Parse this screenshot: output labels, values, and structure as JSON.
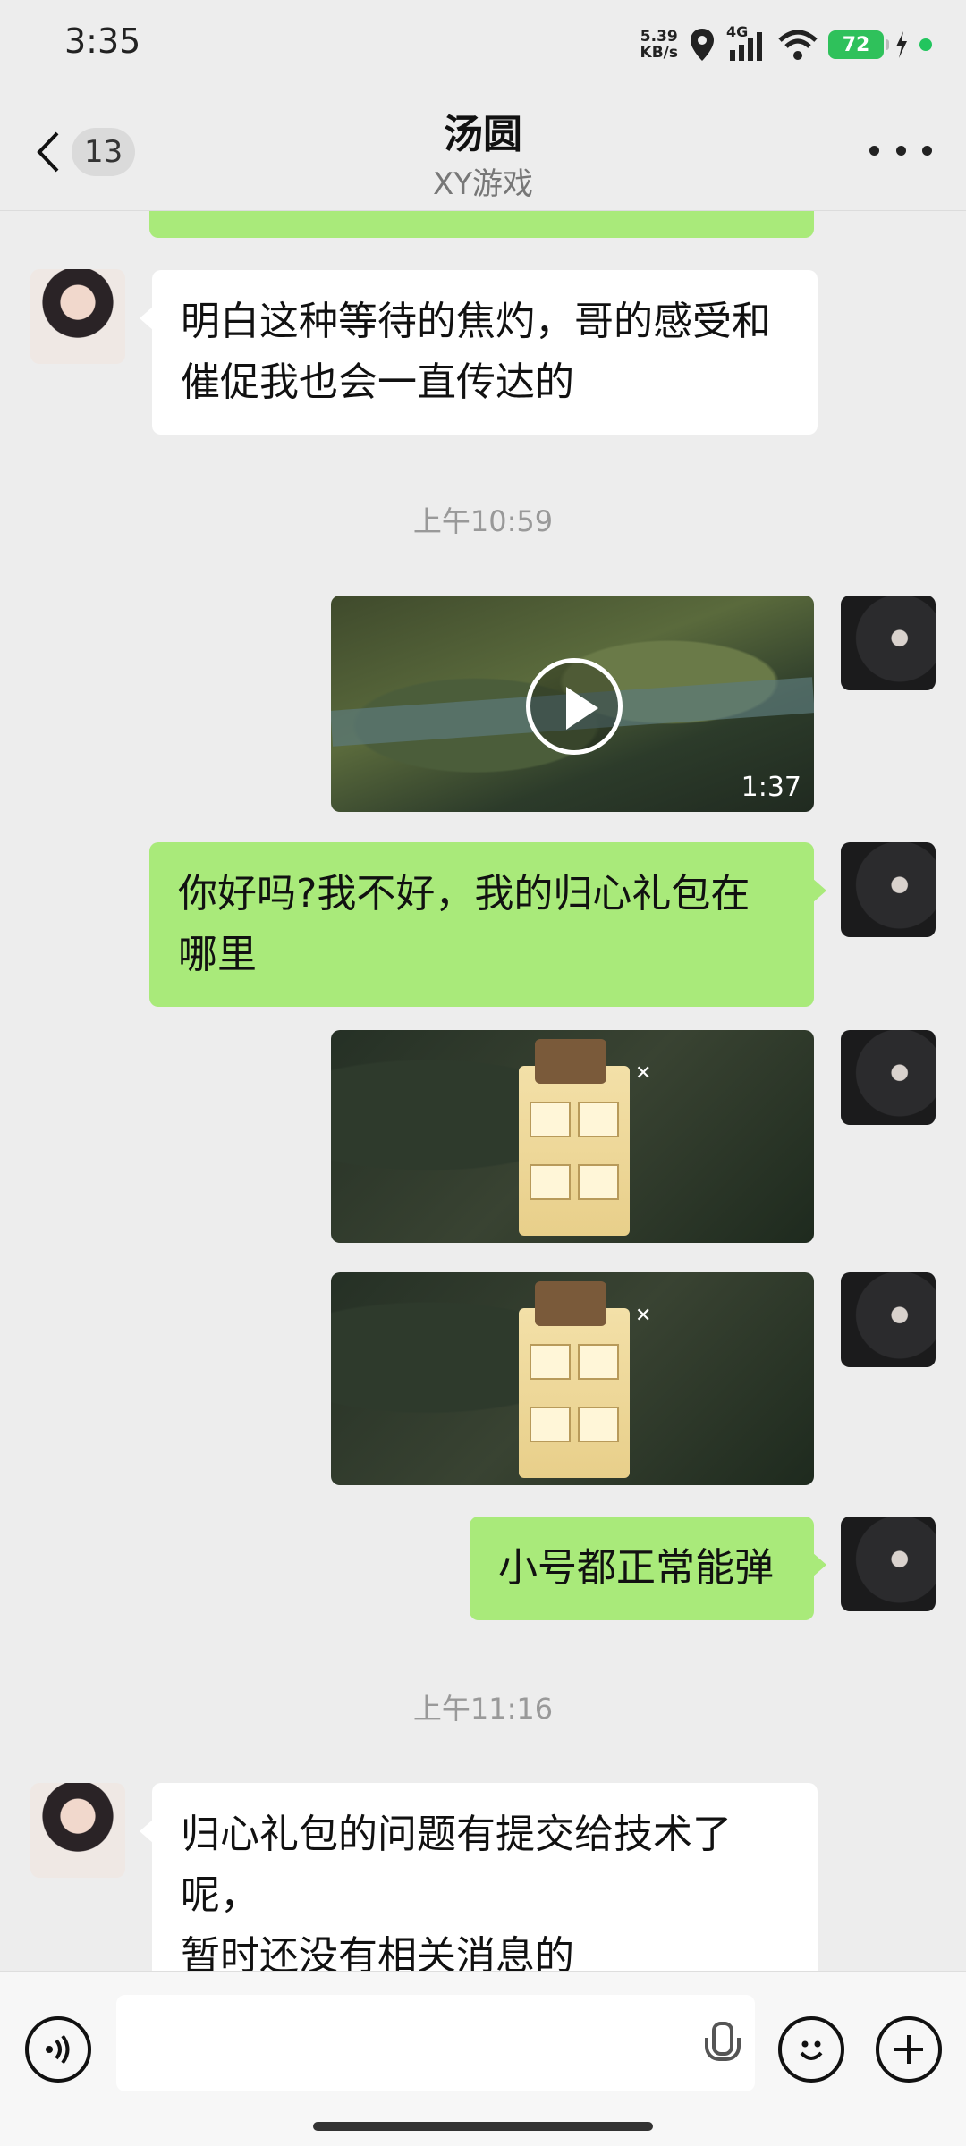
{
  "status_bar": {
    "time": "3:35",
    "net_speed_value": "5.39",
    "net_speed_unit": "KB/s",
    "network": "4G",
    "battery": "72",
    "icons": [
      "location-icon",
      "signal-icon",
      "wifi-icon",
      "charging-icon"
    ]
  },
  "header": {
    "back_badge": "13",
    "title": "汤圆",
    "subtitle": "XY游戏"
  },
  "messages": [
    {
      "side": "left",
      "type": "text",
      "text_line1": "明白这种等待的焦灼，哥的感受和",
      "text_line2": "催促我也会一直传达的"
    },
    {
      "type": "timestamp",
      "text": "上午10:59"
    },
    {
      "side": "right",
      "type": "video",
      "duration": "1:37"
    },
    {
      "side": "right",
      "type": "text",
      "text_line1": "你好吗?我不好，我的归心礼包在",
      "text_line2": "哪里"
    },
    {
      "side": "right",
      "type": "image"
    },
    {
      "side": "right",
      "type": "image"
    },
    {
      "side": "right",
      "type": "text",
      "text_line1": "小号都正常能弹"
    },
    {
      "type": "timestamp",
      "text": "上午11:16"
    },
    {
      "side": "left",
      "type": "text",
      "text_line1": "归心礼包的问题有提交给技术了呢，",
      "text_line2": "暂时还没有相关消息的"
    }
  ],
  "input_bar": {
    "placeholder": "",
    "icons": [
      "voice-icon",
      "mic-icon",
      "emoji-icon",
      "plus-icon"
    ]
  },
  "colors": {
    "background": "#ededed",
    "sent_bubble": "#a9ea7a",
    "received_bubble": "#ffffff",
    "battery": "#2fc15b"
  }
}
